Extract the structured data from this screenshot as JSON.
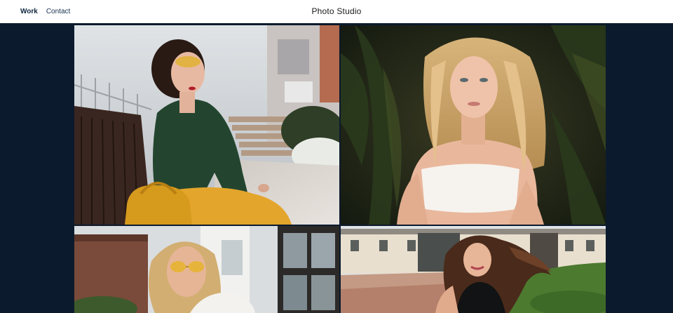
{
  "header": {
    "brand": "Photo Studio",
    "nav": [
      {
        "label": "Work",
        "active": true
      },
      {
        "label": "Contact",
        "active": false
      }
    ]
  },
  "gallery": {
    "photos": [
      {
        "subject": "woman with sunglasses on bench"
      },
      {
        "subject": "blonde woman portrait"
      },
      {
        "subject": "woman with yellow sunglasses"
      },
      {
        "subject": "woman with flowing hair outdoors"
      }
    ]
  },
  "colors": {
    "page_background": "#0c1a2d",
    "header_background": "#ffffff",
    "nav_text": "#17304f"
  }
}
